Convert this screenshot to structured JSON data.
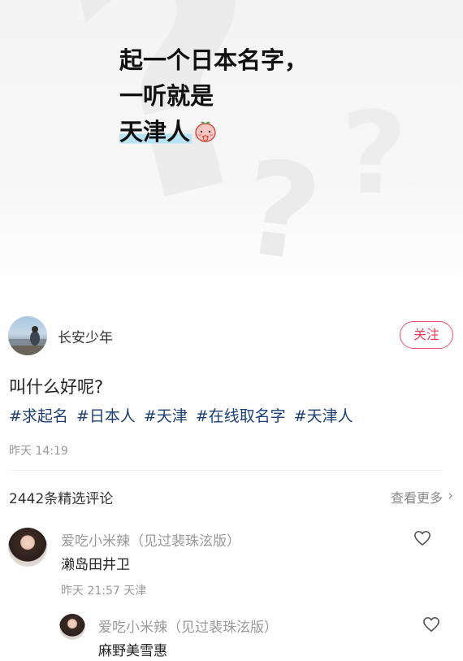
{
  "cover": {
    "line1": "起一个日本名字，",
    "line2": "一听就是",
    "line3": "天津人"
  },
  "author": {
    "name": "长安少年",
    "follow_label": "关注"
  },
  "post": {
    "title": "叫什么好呢?",
    "tags": [
      "#求起名",
      "#日本人",
      "#天津",
      "#在线取名字",
      "#天津人"
    ],
    "time": "昨天 14:19"
  },
  "comments_header": {
    "count_label": "2442条精选评论",
    "see_more_label": "查看更多",
    "chevron": "›"
  },
  "comments": [
    {
      "user": "爱吃小米辣（见过裴珠泫版）",
      "text": "濑岛田井卫",
      "meta": "昨天 21:57 天津"
    },
    {
      "user": "爱吃小米辣（见过裴珠泫版）",
      "text": "麻野美雪惠"
    }
  ],
  "colors": {
    "accent": "#e8405f",
    "tag": "#1b3f73",
    "highlight": "#b9e2f2"
  },
  "icons": {
    "emoji": "peach-face-icon",
    "like": "heart-outline-icon"
  }
}
